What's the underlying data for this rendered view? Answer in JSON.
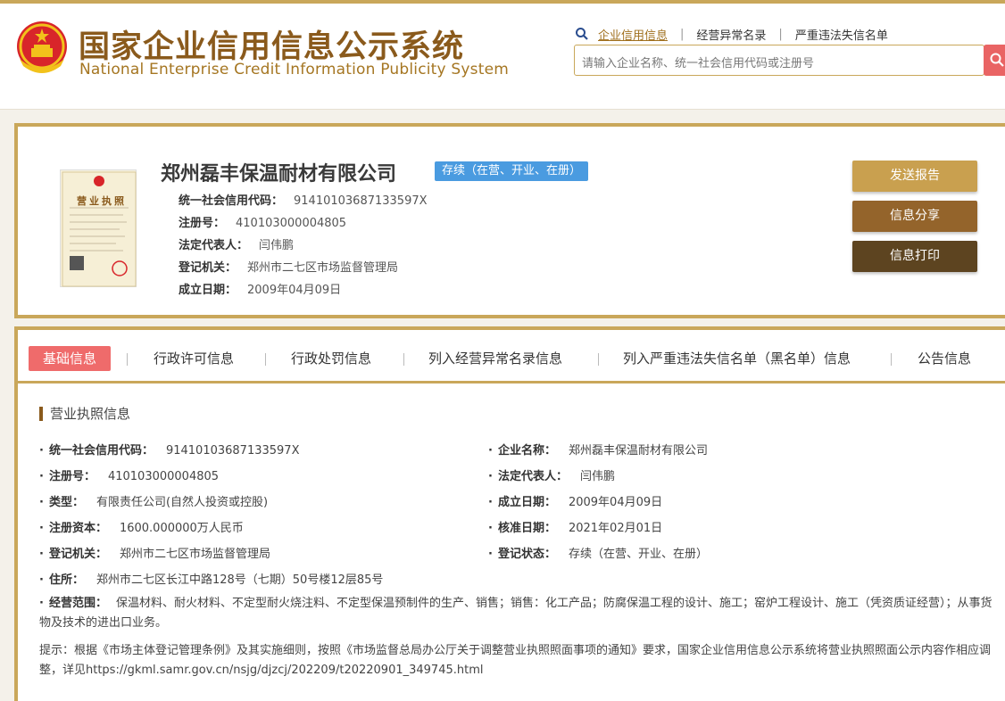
{
  "header": {
    "title_cn": "国家企业信用信息公示系统",
    "title_en": "National Enterprise Credit Information Publicity System",
    "search_tabs": [
      "企业信用信息",
      "经营异常名录",
      "严重违法失信名单"
    ],
    "search_placeholder": "请输入企业名称、统一社会信用代码或注册号"
  },
  "company": {
    "name": "郑州磊丰保温耐材有限公司",
    "status": "存续（在营、开业、在册）",
    "fields": [
      {
        "label": "统一社会信用代码：",
        "value": "91410103687133597X"
      },
      {
        "label": "注册号：",
        "value": "410103000004805"
      },
      {
        "label": "法定代表人：",
        "value": "闫伟鹏"
      },
      {
        "label": "登记机关：",
        "value": "郑州市二七区市场监督管理局"
      },
      {
        "label": "成立日期：",
        "value": "2009年04月09日"
      }
    ],
    "buttons": {
      "send": "发送报告",
      "share": "信息分享",
      "print": "信息打印"
    },
    "license_text": "营业执照"
  },
  "tabs": [
    "基础信息",
    "行政许可信息",
    "行政处罚信息",
    "列入经营异常名录信息",
    "列入严重违法失信名单（黑名单）信息",
    "公告信息"
  ],
  "section": {
    "title": "营业执照信息",
    "left": [
      {
        "label": "统一社会信用代码：",
        "value": "91410103687133597X"
      },
      {
        "label": "注册号：",
        "value": "410103000004805"
      },
      {
        "label": "类型：",
        "value": "有限责任公司(自然人投资或控股)"
      },
      {
        "label": "注册资本：",
        "value": "1600.000000万人民币"
      },
      {
        "label": "登记机关：",
        "value": "郑州市二七区市场监督管理局"
      },
      {
        "label": "住所：",
        "value": "郑州市二七区长江中路128号（七期）50号楼12层85号"
      }
    ],
    "right": [
      {
        "label": "企业名称：",
        "value": "郑州磊丰保温耐材有限公司"
      },
      {
        "label": "法定代表人：",
        "value": "闫伟鹏"
      },
      {
        "label": "成立日期：",
        "value": "2009年04月09日"
      },
      {
        "label": "核准日期：",
        "value": "2021年02月01日"
      },
      {
        "label": "登记状态：",
        "value": "存续（在营、开业、在册）"
      }
    ],
    "scope_label": "经营范围：",
    "scope_value": "保温材料、耐火材料、不定型耐火烧注料、不定型保温预制件的生产、销售；销售：化工产品；防腐保温工程的设计、施工；窑炉工程设计、施工（凭资质证经营）；从事货物及技术的进出口业务。",
    "notice": "提示：根据《市场主体登记管理条例》及其实施细则，按照《市场监督总局办公厅关于调整营业执照照面事项的通知》要求，国家企业信用信息公示系统将营业执照照面公示内容作相应调整，详见https://gkml.samr.gov.cn/nsjg/djzcj/202209/t20220901_349745.html"
  },
  "colors": {
    "gold": "#c9a75a",
    "brown": "#8a5a1c",
    "tab_active": "#ef6b6b",
    "badge": "#4a9be0"
  }
}
